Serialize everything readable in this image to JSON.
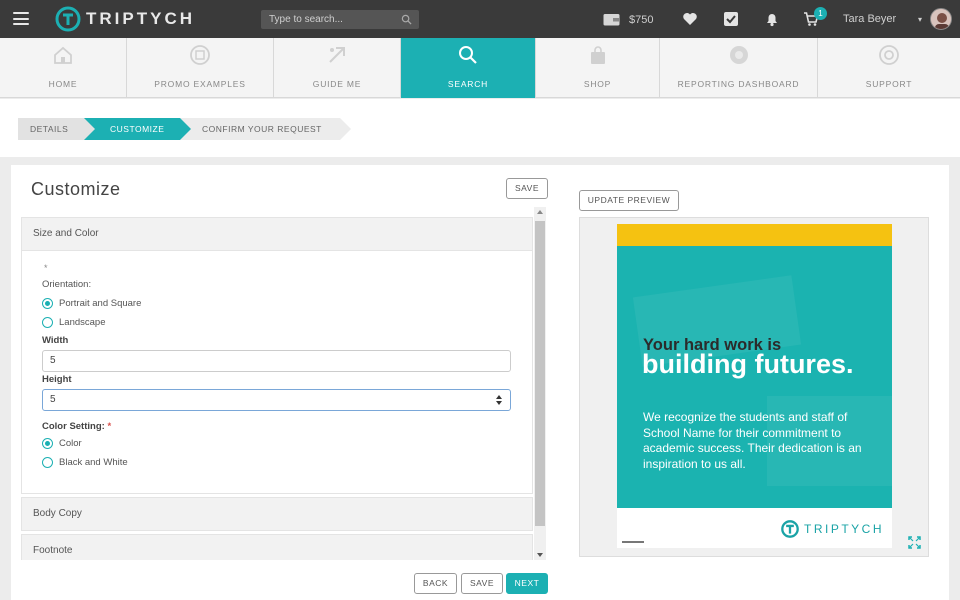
{
  "topbar": {
    "brand": "TRIPTYCH",
    "search_placeholder": "Type to search...",
    "balance": "$750",
    "cart_count": "1",
    "user_name": "Tara Beyer"
  },
  "nav": {
    "tabs": [
      {
        "label": "HOME",
        "icon": "home-icon"
      },
      {
        "label": "PROMO EXAMPLES",
        "icon": "promo-examples-icon"
      },
      {
        "label": "GUIDE ME",
        "icon": "guide-me-icon"
      },
      {
        "label": "SEARCH",
        "icon": "search-icon",
        "active": true
      },
      {
        "label": "SHOP",
        "icon": "shop-bag-icon"
      },
      {
        "label": "REPORTING DASHBOARD",
        "icon": "reporting-dashboard-icon"
      },
      {
        "label": "SUPPORT",
        "icon": "support-icon"
      }
    ]
  },
  "steps": [
    {
      "label": "DETAILS"
    },
    {
      "label": "CUSTOMIZE",
      "active": true
    },
    {
      "label": "CONFIRM YOUR REQUEST"
    }
  ],
  "customize": {
    "title": "Customize",
    "save_label": "SAVE",
    "sections": {
      "size_color": "Size and Color",
      "body_copy": "Body Copy",
      "footnote": "Footnote"
    },
    "required_mark": "*",
    "orientation_label": "Orientation:",
    "orientation_options": [
      "Portrait and Square",
      "Landscape"
    ],
    "orientation_selected": "Portrait and Square",
    "width_label": "Width",
    "width_value": "5",
    "height_label": "Height",
    "height_value": "5",
    "color_setting_label": "Color Setting:",
    "color_options": [
      "Color",
      "Black and White"
    ],
    "color_selected": "Color"
  },
  "buttons": {
    "back": "BACK",
    "save": "SAVE",
    "next": "NEXT",
    "update_preview": "UPDATE PREVIEW"
  },
  "preview": {
    "headline": "Your hard work is",
    "headline_big": "building futures.",
    "body": "We recognize the students and staff of School Name for their commitment to academic success. Their dedication is an inspiration to us all.",
    "brand": "TRIPTYCH"
  },
  "colors": {
    "accent": "#1cb0b3",
    "topbar": "#3a3a3a",
    "poster_band": "#f5c211",
    "poster_teal": "#1bb3b0"
  }
}
